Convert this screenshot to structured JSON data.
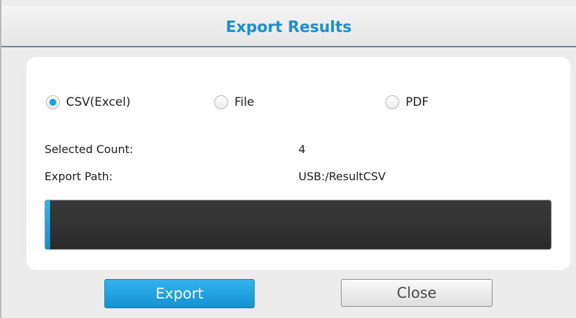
{
  "dialog": {
    "title": "Export Results"
  },
  "format_options": [
    {
      "label": "CSV(Excel)",
      "checked": true
    },
    {
      "label": "File",
      "checked": false
    },
    {
      "label": "PDF",
      "checked": false
    }
  ],
  "info": {
    "selected_count_label": "Selected Count:",
    "selected_count_value": "4",
    "export_path_label": "Export Path:",
    "export_path_value": "USB:/ResultCSV"
  },
  "progress": {
    "fraction": 0.01
  },
  "buttons": {
    "export_label": "Export",
    "close_label": "Close"
  },
  "colors": {
    "accent": "#1a8fd0",
    "radio_checked": "#1aa1e0",
    "progress_track": "#2e2e2e",
    "export_button": "#1e9fe0"
  }
}
